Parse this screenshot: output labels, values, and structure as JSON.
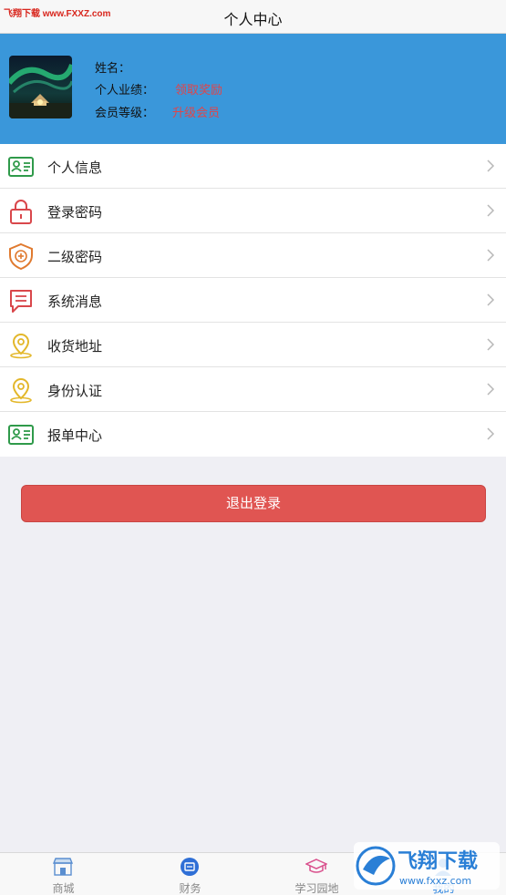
{
  "watermark_top": "飞翔下载 www.FXXZ.com",
  "header": {
    "title": "个人中心"
  },
  "profile": {
    "name_label": "姓名：",
    "performance_label": "个人业绩：",
    "claim_reward": "领取奖励",
    "level_label": "会员等级：",
    "upgrade": "升级会员"
  },
  "menu": [
    {
      "label": "个人信息",
      "icon": "id-card-icon",
      "color": "#2f9a4a"
    },
    {
      "label": "登录密码",
      "icon": "lock-icon",
      "color": "#d9474b"
    },
    {
      "label": "二级密码",
      "icon": "shield-plus-icon",
      "color": "#e07a2f"
    },
    {
      "label": "系统消息",
      "icon": "message-icon",
      "color": "#d9474b"
    },
    {
      "label": "收货地址",
      "icon": "location-pin-icon",
      "color": "#e3b72a"
    },
    {
      "label": "身份认证",
      "icon": "location-pin-icon",
      "color": "#e3b72a"
    },
    {
      "label": "报单中心",
      "icon": "id-card-icon",
      "color": "#2f9a4a"
    }
  ],
  "logout_label": "退出登录",
  "tabbar": [
    {
      "label": "商城",
      "icon": "store-icon"
    },
    {
      "label": "财务",
      "icon": "finance-icon"
    },
    {
      "label": "学习园地",
      "icon": "graduation-cap-icon"
    },
    {
      "label": "我的",
      "icon": "user-icon",
      "active": true
    }
  ],
  "watermark_logo": "飞翔下载 www.fxxz.com"
}
